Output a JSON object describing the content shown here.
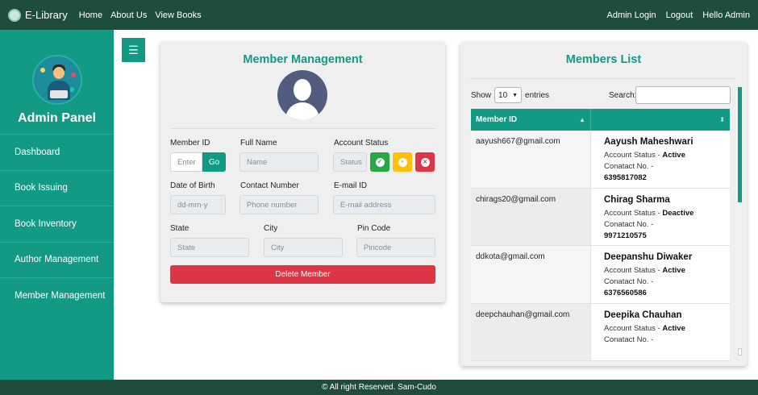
{
  "navbar": {
    "brand": "E-Library",
    "links": [
      "Home",
      "About Us",
      "View Books"
    ],
    "right_links": [
      "Admin Login",
      "Logout",
      "Hello Admin"
    ]
  },
  "sidebar": {
    "title": "Admin Panel",
    "items": [
      "Dashboard",
      "Book Issuing",
      "Book Inventory",
      "Author Management",
      "Member Management"
    ]
  },
  "toggle_icon": "☰",
  "member_form": {
    "title": "Member Management",
    "member_id_label": "Member ID",
    "member_id_placeholder": "Enter",
    "go_label": "Go",
    "full_name_label": "Full Name",
    "full_name_placeholder": "Name",
    "account_status_label": "Account Status",
    "status_placeholder": "Status",
    "dob_label": "Date of Birth",
    "dob_placeholder": "dd-mm-y",
    "contact_label": "Contact Number",
    "contact_placeholder": "Phone number",
    "email_label": "E-mail ID",
    "email_placeholder": "E-mail address",
    "state_label": "State",
    "state_placeholder": "State",
    "city_label": "City",
    "city_placeholder": "City",
    "pin_label": "Pin Code",
    "pin_placeholder": "Pincode",
    "delete_label": "Delete Member",
    "status_buttons": [
      {
        "icon": "check-icon",
        "color": "#28a745",
        "glyph": "✓"
      },
      {
        "icon": "pause-icon",
        "color": "#ffc107",
        "glyph": "⏸"
      },
      {
        "icon": "close-icon",
        "color": "#dc3545",
        "glyph": "✕"
      }
    ]
  },
  "members_list": {
    "title": "Members List",
    "show_label": "Show",
    "entries_value": "10",
    "entries_label": "entries",
    "search_label": "Search:",
    "column_header": "Member ID",
    "status_prefix": "Account Status -",
    "contact_prefix": "Conatact No. -",
    "rows": [
      {
        "id": "aayush667@gmail.com",
        "name": "Aayush Maheshwari",
        "status": "Active",
        "phone": "6395817082"
      },
      {
        "id": "chirags20@gmail.com",
        "name": "Chirag Sharma",
        "status": "Deactive",
        "phone": "9971210575"
      },
      {
        "id": "ddkota@gmail.com",
        "name": "Deepanshu Diwaker",
        "status": "Active",
        "phone": "6376560586"
      },
      {
        "id": "deepchauhan@gmail.com",
        "name": "Deepika Chauhan",
        "status": "Active",
        "phone": ""
      }
    ]
  },
  "footer": {
    "text": "© All right Reserved. Sam-Cudo"
  },
  "colors": {
    "primary": "#139a85",
    "navbar": "#1f4d3b",
    "danger": "#dc3545"
  }
}
